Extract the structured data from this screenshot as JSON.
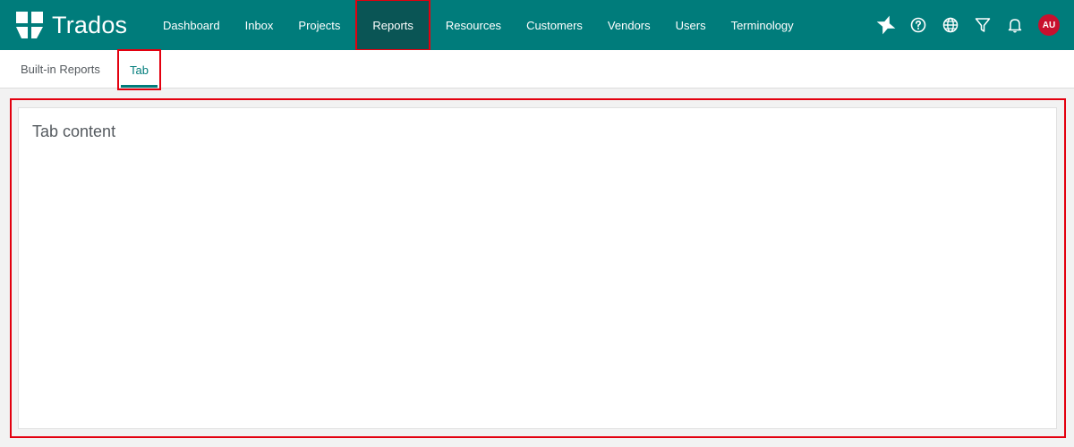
{
  "brand": {
    "name": "Trados",
    "color": "#007c7b"
  },
  "nav": {
    "items": [
      {
        "label": "Dashboard"
      },
      {
        "label": "Inbox"
      },
      {
        "label": "Projects"
      },
      {
        "label": "Reports",
        "active": true
      },
      {
        "label": "Resources"
      },
      {
        "label": "Customers"
      },
      {
        "label": "Vendors"
      },
      {
        "label": "Users"
      },
      {
        "label": "Terminology"
      }
    ]
  },
  "toolbar": {
    "icons": [
      "ai-assistant-icon",
      "help-icon",
      "globe-icon",
      "filter-icon",
      "bell-icon"
    ],
    "avatar_initials": "AU",
    "avatar_color": "#c8102e"
  },
  "subtabs": {
    "items": [
      {
        "label": "Built-in Reports"
      },
      {
        "label": "Tab",
        "active": true
      }
    ]
  },
  "main": {
    "content_text": "Tab content"
  },
  "colors": {
    "highlight": "#e3000f",
    "active_nav_bg": "#0a5555",
    "background": "#f2f2f2"
  }
}
